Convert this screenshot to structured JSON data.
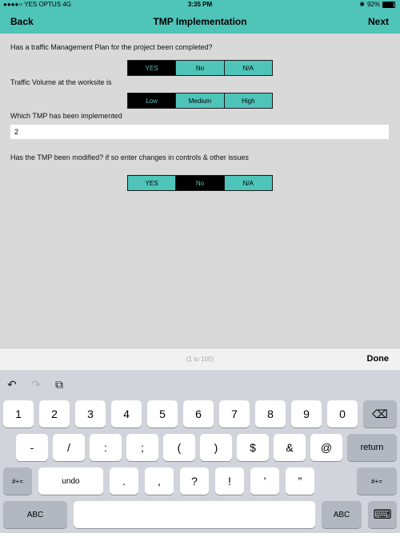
{
  "status": {
    "carrier": "●●●●○ YES OPTUS  4G",
    "time": "3:35 PM",
    "bluetooth": "✱",
    "battery_text": "92%",
    "battery_level": 0.92
  },
  "nav": {
    "back": "Back",
    "title": "TMP Implementation",
    "next": "Next"
  },
  "form": {
    "q1": {
      "label": "Has a traffic Management Plan for the project been completed?",
      "options": [
        "YES",
        "No",
        "N/A"
      ],
      "selected": 0
    },
    "q2": {
      "label": "Traffic Volume at the worksite is",
      "options": [
        "Low",
        "Medium",
        "High"
      ],
      "selected": 0
    },
    "q3": {
      "label": "Which TMP has been implemented",
      "value": "2"
    },
    "q4": {
      "label": "Has the TMP been modified? if so enter changes in controls & other issues",
      "options": [
        "YES",
        "No",
        "N/A"
      ],
      "selected": 1
    }
  },
  "toolbar": {
    "range_hint": "(1 to 100)",
    "done": "Done"
  },
  "keyboard": {
    "tools": {
      "undo_icon": "↶",
      "redo_icon": "↷",
      "paste_icon": "⧉"
    },
    "row1": [
      "1",
      "2",
      "3",
      "4",
      "5",
      "6",
      "7",
      "8",
      "9",
      "0"
    ],
    "backspace_icon": "⌫",
    "row2": [
      "-",
      "/",
      ":",
      ";",
      "(",
      ")",
      "$",
      "&",
      "@"
    ],
    "return": "return",
    "row3_left": "#+=",
    "row3": [
      "undo",
      ".",
      ",",
      "?",
      "!",
      "’",
      "”"
    ],
    "row3_right": "#+=",
    "abc_left": "ABC",
    "abc_right": "ABC",
    "hide_keyboard_icon": "⌨"
  },
  "colors": {
    "accent": "#4fc4b8",
    "selected": "#000000"
  }
}
